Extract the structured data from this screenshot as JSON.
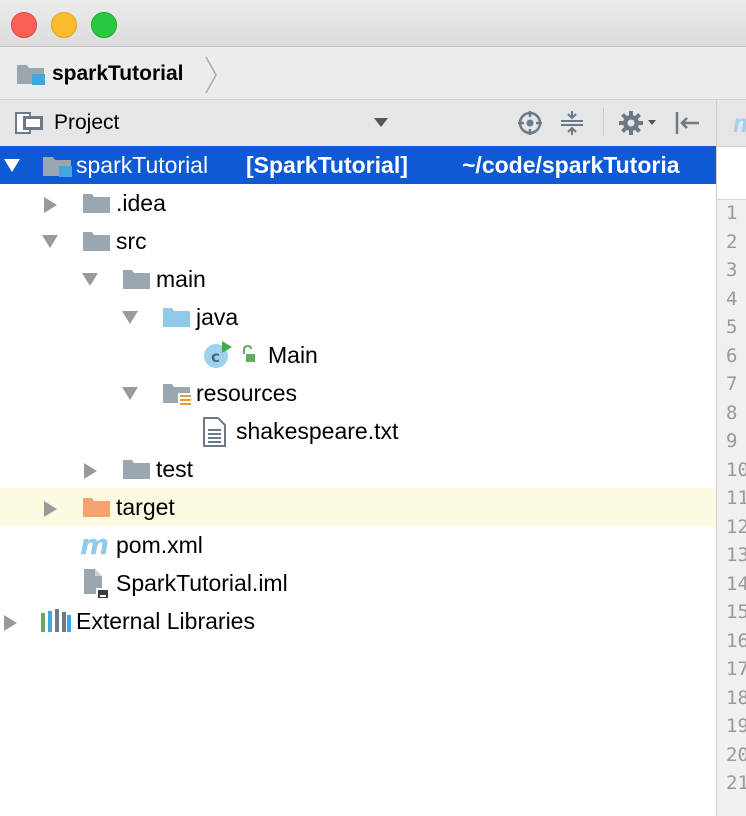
{
  "breadcrumb": {
    "project": "sparkTutorial"
  },
  "toolwindow": {
    "title": "Project"
  },
  "tree": {
    "root": {
      "name": "sparkTutorial",
      "module": "[SparkTutorial]",
      "path": "~/code/sparkTutoria"
    },
    "items": [
      {
        "label": ".idea"
      },
      {
        "label": "src"
      },
      {
        "label": "main"
      },
      {
        "label": "java"
      },
      {
        "label": "Main"
      },
      {
        "label": "resources"
      },
      {
        "label": "shakespeare.txt"
      },
      {
        "label": "test"
      },
      {
        "label": "target"
      },
      {
        "label": "pom.xml"
      },
      {
        "label": "SparkTutorial.iml"
      },
      {
        "label": "External Libraries"
      }
    ]
  },
  "gutter": {
    "lines": [
      "1",
      "2",
      "3",
      "4",
      "5",
      "6",
      "7",
      "8",
      "9",
      "10",
      "11",
      "12",
      "13",
      "14",
      "15",
      "16",
      "17",
      "18",
      "19",
      "20",
      "21"
    ]
  },
  "colors": {
    "selection": "#0e59d4",
    "highlight_row": "#fcfae0",
    "folder": "#9aa7b0",
    "source_folder": "#8fcbe8",
    "excluded_folder": "#f5a26f"
  }
}
